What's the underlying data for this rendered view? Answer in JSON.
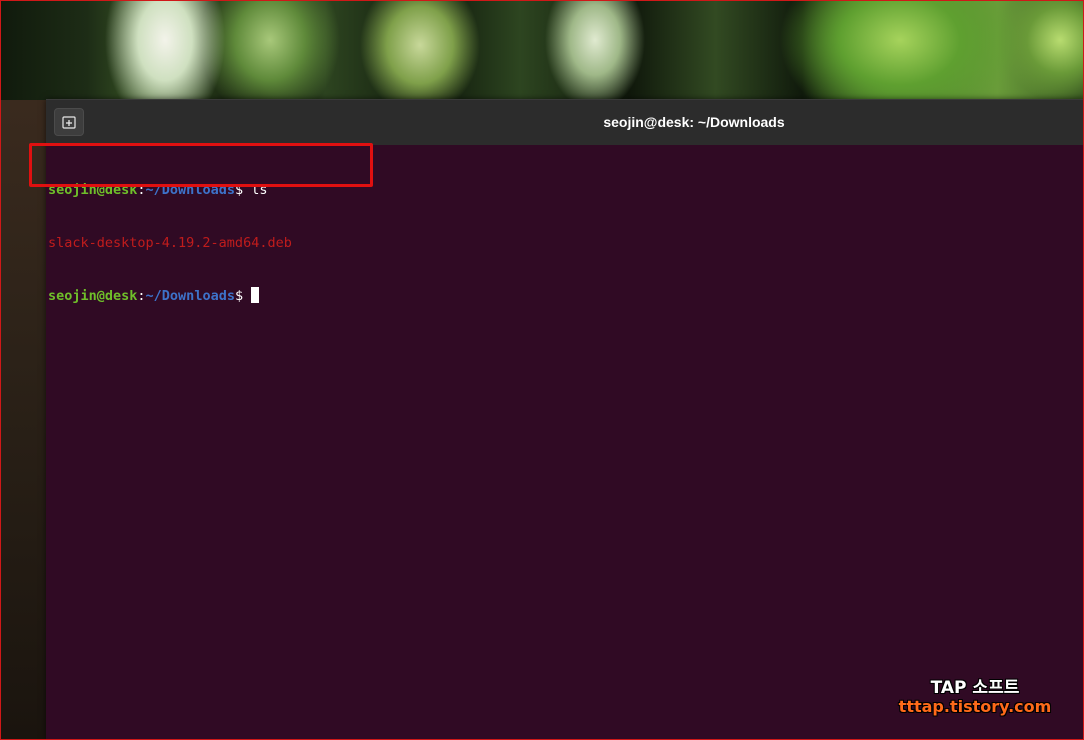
{
  "window": {
    "title": "seojin@desk: ~/Downloads"
  },
  "terminal": {
    "lines": [
      {
        "user": "seojin@desk",
        "colon": ":",
        "path": "~/Downloads",
        "dollar": "$ ",
        "command": "ls"
      },
      {
        "output": "slack-desktop-4.19.2-amd64.deb"
      },
      {
        "user": "seojin@desk",
        "colon": ":",
        "path": "~/Downloads",
        "dollar": "$ "
      }
    ]
  },
  "watermark": {
    "title": "TAP 소프트",
    "url": "tttap.tistory.com"
  },
  "colors": {
    "terminal_bg": "#300a24",
    "prompt_user": "#6fbf2a",
    "prompt_path": "#3d72c9",
    "deb_file": "#c01c1c",
    "highlight": "#e01010"
  },
  "icons": {
    "new_tab": "new-tab-icon"
  }
}
